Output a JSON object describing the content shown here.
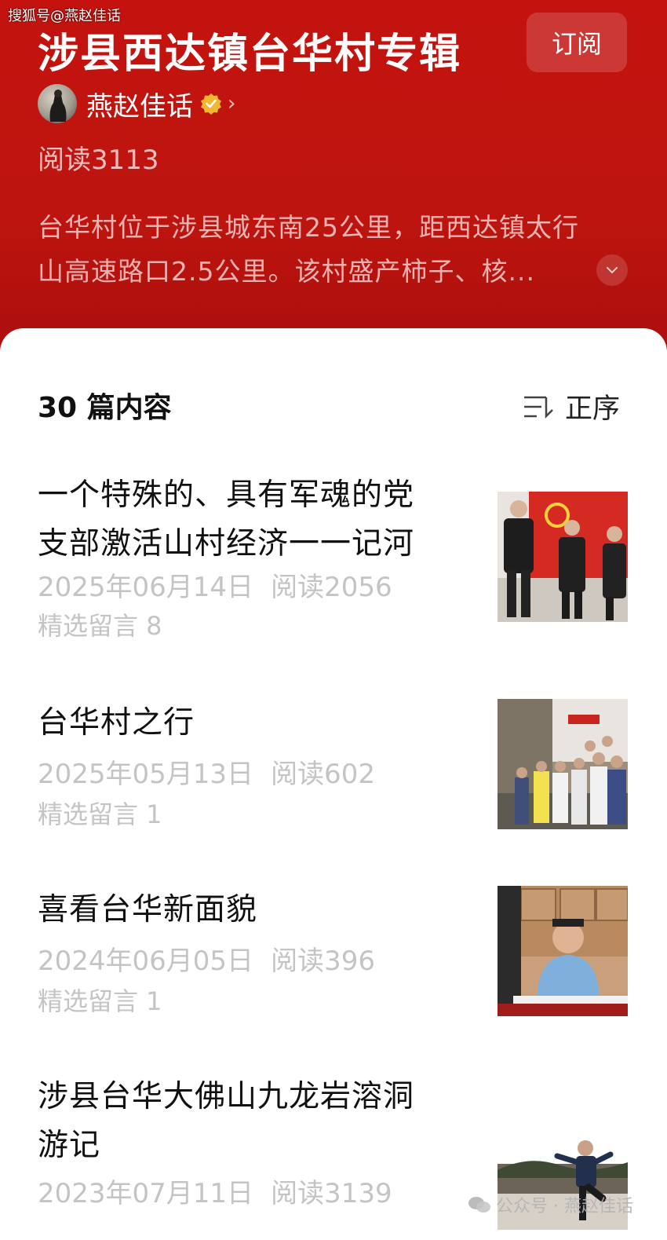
{
  "watermark_top": "搜狐号@燕赵佳话",
  "album": {
    "title": "涉县西达镇台华村专辑",
    "subscribe_label": "订阅",
    "author": "燕赵佳话",
    "read_count": "阅读3113",
    "intro_line1": "台华村位于涉县城东南25公里，距西达镇太行",
    "intro_line2": "山高速路口2.5公里。该村盛产柿子、核..."
  },
  "list": {
    "count_label": "30 篇内容",
    "sort_label": "正序",
    "items": [
      {
        "title_line1": "一个特殊的、具有军魂的党",
        "title_line2": "支部激活山村经济一一记河",
        "date": "2025年06月14日",
        "reads": "阅读2056",
        "comments": "精选留言 8"
      },
      {
        "title_line1": "台华村之行",
        "date": "2025年05月13日",
        "reads": "阅读602",
        "comments": "精选留言 1"
      },
      {
        "title_line1": "喜看台华新面貌",
        "date": "2024年06月05日",
        "reads": "阅读396",
        "comments": "精选留言 1"
      },
      {
        "title_line1": "涉县台华大佛山九龙岩溶洞",
        "title_line2": "游记",
        "date": "2023年07月11日",
        "reads": "阅读3139"
      }
    ]
  },
  "watermark_bottom": "公众号 · 燕赵佳话",
  "colors": {
    "header_red": "#c4130f",
    "verified_gold": "#f2b630",
    "meta_gray": "#c4c4c4"
  }
}
